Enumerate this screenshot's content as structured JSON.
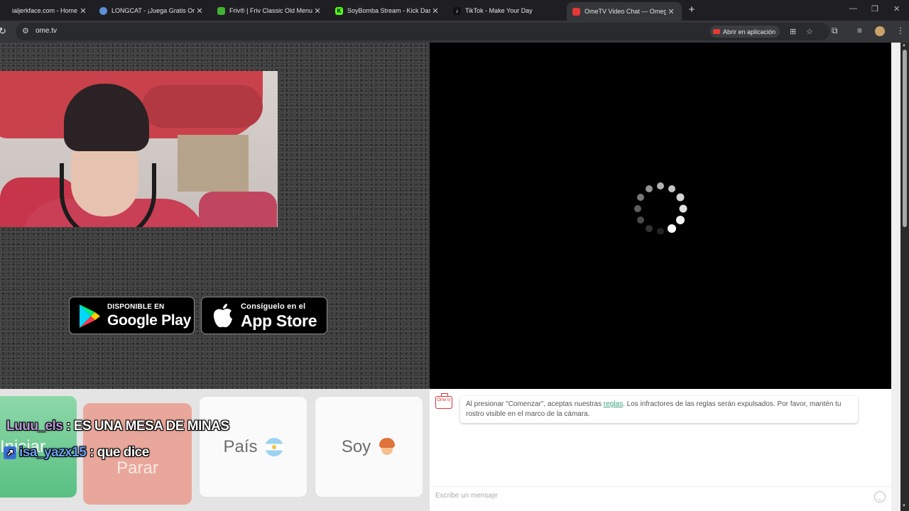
{
  "browser": {
    "tabs": [
      {
        "title": "ialjerkface.com - Home Of H",
        "fav_color": "#555555",
        "fav_char": ""
      },
      {
        "title": "LONGCAT - ¡Juega Gratis Onlin",
        "fav_color": "#5c8fd6",
        "fav_char": ""
      },
      {
        "title": "Friv® | Friv Classic Old Menu",
        "fav_color": "#43b233",
        "fav_char": ""
      },
      {
        "title": "SoyBomba Stream - Kick Dashb",
        "fav_color": "#53fc18",
        "fav_char": "K"
      },
      {
        "title": "TikTok - Make Your Day",
        "fav_color": "#111111",
        "fav_char": "♪"
      },
      {
        "title": "OmeTV Video Chat — Omegle",
        "fav_color": "#e53935",
        "fav_char": ""
      }
    ],
    "url": "ome.tv",
    "open_in_app_label": "Abrir en aplicación"
  },
  "stores": {
    "google_small": "DISPONIBLE EN",
    "google_big": "Google Play",
    "apple_small": "Consíguelo en el",
    "apple_big": "App Store"
  },
  "controls": {
    "start_label": "Iniciar",
    "stop_label": "Parar",
    "country_label": "País",
    "gender_label": "Soy"
  },
  "overlay_chat": [
    {
      "user": "Luuu_els",
      "text": ": ES UNA MESA DE MINAS"
    },
    {
      "user": "isa_yazx15",
      "text": ": que dice"
    }
  ],
  "chat": {
    "logo_text": "Ome tv",
    "system_before": "Al presionar \"Comenzar\", aceptas nuestras ",
    "system_link": "reglas",
    "system_after": ". Los infractores de las reglas serán expulsados. Por favor, mantén tu rostro visible en el marco de la cámara.",
    "input_placeholder": "Escribe un mensaje"
  }
}
